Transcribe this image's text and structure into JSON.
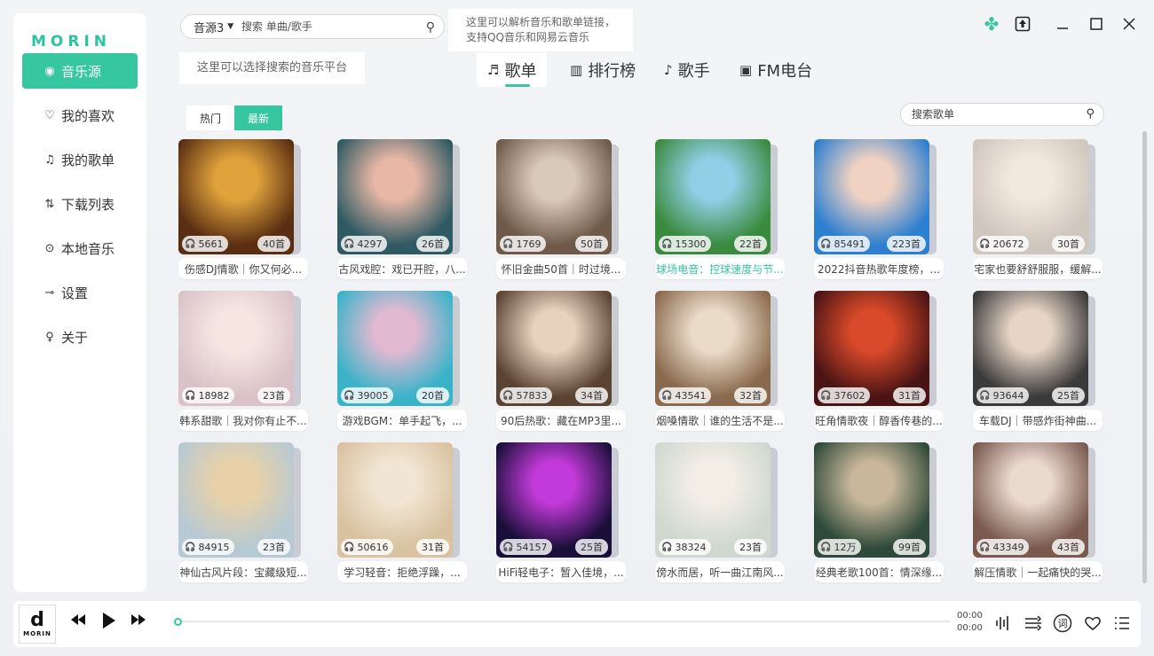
{
  "app": {
    "logo": "MORIN"
  },
  "sidebar": {
    "items": [
      {
        "label": "音乐源",
        "icon": "disc-icon",
        "glyph": "◉",
        "active": true
      },
      {
        "label": "我的喜欢",
        "icon": "heart-icon",
        "glyph": "♡",
        "active": false
      },
      {
        "label": "我的歌单",
        "icon": "playlist-icon",
        "glyph": "♫",
        "active": false
      },
      {
        "label": "下载列表",
        "icon": "download-icon",
        "glyph": "⇅",
        "active": false
      },
      {
        "label": "本地音乐",
        "icon": "play-circle-icon",
        "glyph": "⊙",
        "active": false
      },
      {
        "label": "设置",
        "icon": "toggle-icon",
        "glyph": "⊸",
        "active": false
      },
      {
        "label": "关于",
        "icon": "bulb-icon",
        "glyph": "♀",
        "active": false
      }
    ]
  },
  "header": {
    "source_label": "音源3",
    "search_placeholder": "搜索 单曲/歌手",
    "tip_parse_line1": "这里可以解析音乐和歌单链接，",
    "tip_parse_line2": "支持QQ音乐和网易云音乐",
    "tip_platform": "这里可以选择搜索的音乐平台"
  },
  "tabs": [
    {
      "label": "歌单",
      "icon": "playlist-icon",
      "glyph": "♬",
      "active": true
    },
    {
      "label": "排行榜",
      "icon": "chart-icon",
      "glyph": "▥",
      "active": false
    },
    {
      "label": "歌手",
      "icon": "singer-icon",
      "glyph": "♪",
      "active": false
    },
    {
      "label": "FM电台",
      "icon": "radio-icon",
      "glyph": "▣",
      "active": false
    }
  ],
  "filters": [
    {
      "label": "热门",
      "active": false
    },
    {
      "label": "最新",
      "active": true
    }
  ],
  "playlist_search_placeholder": "搜索歌单",
  "colors": {
    "accent": "#36c6a0"
  },
  "playlists": [
    {
      "plays": "5661",
      "count": "40首",
      "title": "伤感DJ情歌｜你又何必...",
      "c1": "#5a2e12",
      "c2": "#e0a33b"
    },
    {
      "plays": "4297",
      "count": "26首",
      "title": "古风戏腔：戏已开腔，八...",
      "c1": "#2f5a63",
      "c2": "#e8b7a6"
    },
    {
      "plays": "1769",
      "count": "50首",
      "title": "怀旧金曲50首｜时过境...",
      "c1": "#6f5a4a",
      "c2": "#d9c9b8"
    },
    {
      "plays": "15300",
      "count": "22首",
      "title": "球场电音：控球速度与节...",
      "c1": "#3a8b3f",
      "c2": "#8fd0e6",
      "highlight": true
    },
    {
      "plays": "85491",
      "count": "223首",
      "title": "2022抖音热歌年度榜，...",
      "c1": "#2d7fd0",
      "c2": "#f0d2c2"
    },
    {
      "plays": "20672",
      "count": "30首",
      "title": "宅家也要舒舒服服，缓解...",
      "c1": "#cfc6bd",
      "c2": "#f3e8de"
    },
    {
      "plays": "18982",
      "count": "23首",
      "title": "韩系甜歌｜我对你有止不...",
      "c1": "#d9c3c8",
      "c2": "#f6e6e2"
    },
    {
      "plays": "39005",
      "count": "20首",
      "title": "游戏BGM：单手起飞，...",
      "c1": "#3ab3c9",
      "c2": "#e2b9d2"
    },
    {
      "plays": "57833",
      "count": "34首",
      "title": "90后热歌：藏在MP3里...",
      "c1": "#5b4334",
      "c2": "#e7d2bd"
    },
    {
      "plays": "43541",
      "count": "32首",
      "title": "烟嗓情歌｜谁的生活不是...",
      "c1": "#8a6a4e",
      "c2": "#eadbc8"
    },
    {
      "plays": "37602",
      "count": "31首",
      "title": "旺角情歌夜｜醇香传巷的...",
      "c1": "#4a1414",
      "c2": "#d94a2a"
    },
    {
      "plays": "93644",
      "count": "25首",
      "title": "车载DJ｜带感炸街神曲...",
      "c1": "#3b3a3a",
      "c2": "#e6d5c6"
    },
    {
      "plays": "84915",
      "count": "23首",
      "title": "神仙古风片段：宝藏级短...",
      "c1": "#b7c9d3",
      "c2": "#e8d1a9"
    },
    {
      "plays": "50616",
      "count": "31首",
      "title": "学习轻音：拒绝浮躁，...",
      "c1": "#d8c2a0",
      "c2": "#f1e6d3"
    },
    {
      "plays": "54157",
      "count": "25首",
      "title": "HiFi轻电子：暂入佳境，...",
      "c1": "#1a0f3a",
      "c2": "#c23ad9"
    },
    {
      "plays": "38324",
      "count": "23首",
      "title": "傍水而居，听一曲江南风...",
      "c1": "#cfd8cf",
      "c2": "#f2eee6"
    },
    {
      "plays": "12万",
      "count": "99首",
      "title": "经典老歌100首：情深缘...",
      "c1": "#2f4a3a",
      "c2": "#c8b79a"
    },
    {
      "plays": "43349",
      "count": "43首",
      "title": "解压情歌｜一起痛快的哭...",
      "c1": "#7a5a4e",
      "c2": "#ead9cf"
    }
  ],
  "player": {
    "cover_letter": "d",
    "cover_text": "MORIN",
    "time_current": "00:00",
    "time_total": "00:00",
    "progress": 0
  }
}
